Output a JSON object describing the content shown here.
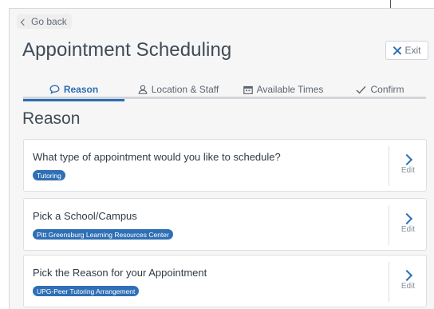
{
  "nav": {
    "back_label": "Go back"
  },
  "header": {
    "title": "Appointment Scheduling",
    "exit_label": "Exit"
  },
  "tabs": [
    {
      "label": "Reason",
      "icon": "chat-bubble-icon",
      "active": true
    },
    {
      "label": "Location & Staff",
      "icon": "person-icon",
      "active": false
    },
    {
      "label": "Available Times",
      "icon": "calendar-icon",
      "active": false
    },
    {
      "label": "Confirm",
      "icon": "checkmark-icon",
      "active": false
    }
  ],
  "section": {
    "title": "Reason"
  },
  "cards": [
    {
      "question": "What type of appointment would you like to schedule?",
      "value": "Tutoring",
      "edit_label": "Edit"
    },
    {
      "question": "Pick a School/Campus",
      "value": "Pitt Greensburg Learning Resources Center",
      "edit_label": "Edit"
    },
    {
      "question": "Pick the Reason for your Appointment",
      "value": "UPG-Peer Tutoring Arrangement",
      "edit_label": "Edit"
    }
  ],
  "colors": {
    "accent": "#2d6db4",
    "badge": "#2f6fb5",
    "panel_bg": "#f6f6f6",
    "text": "#3f4a55"
  }
}
